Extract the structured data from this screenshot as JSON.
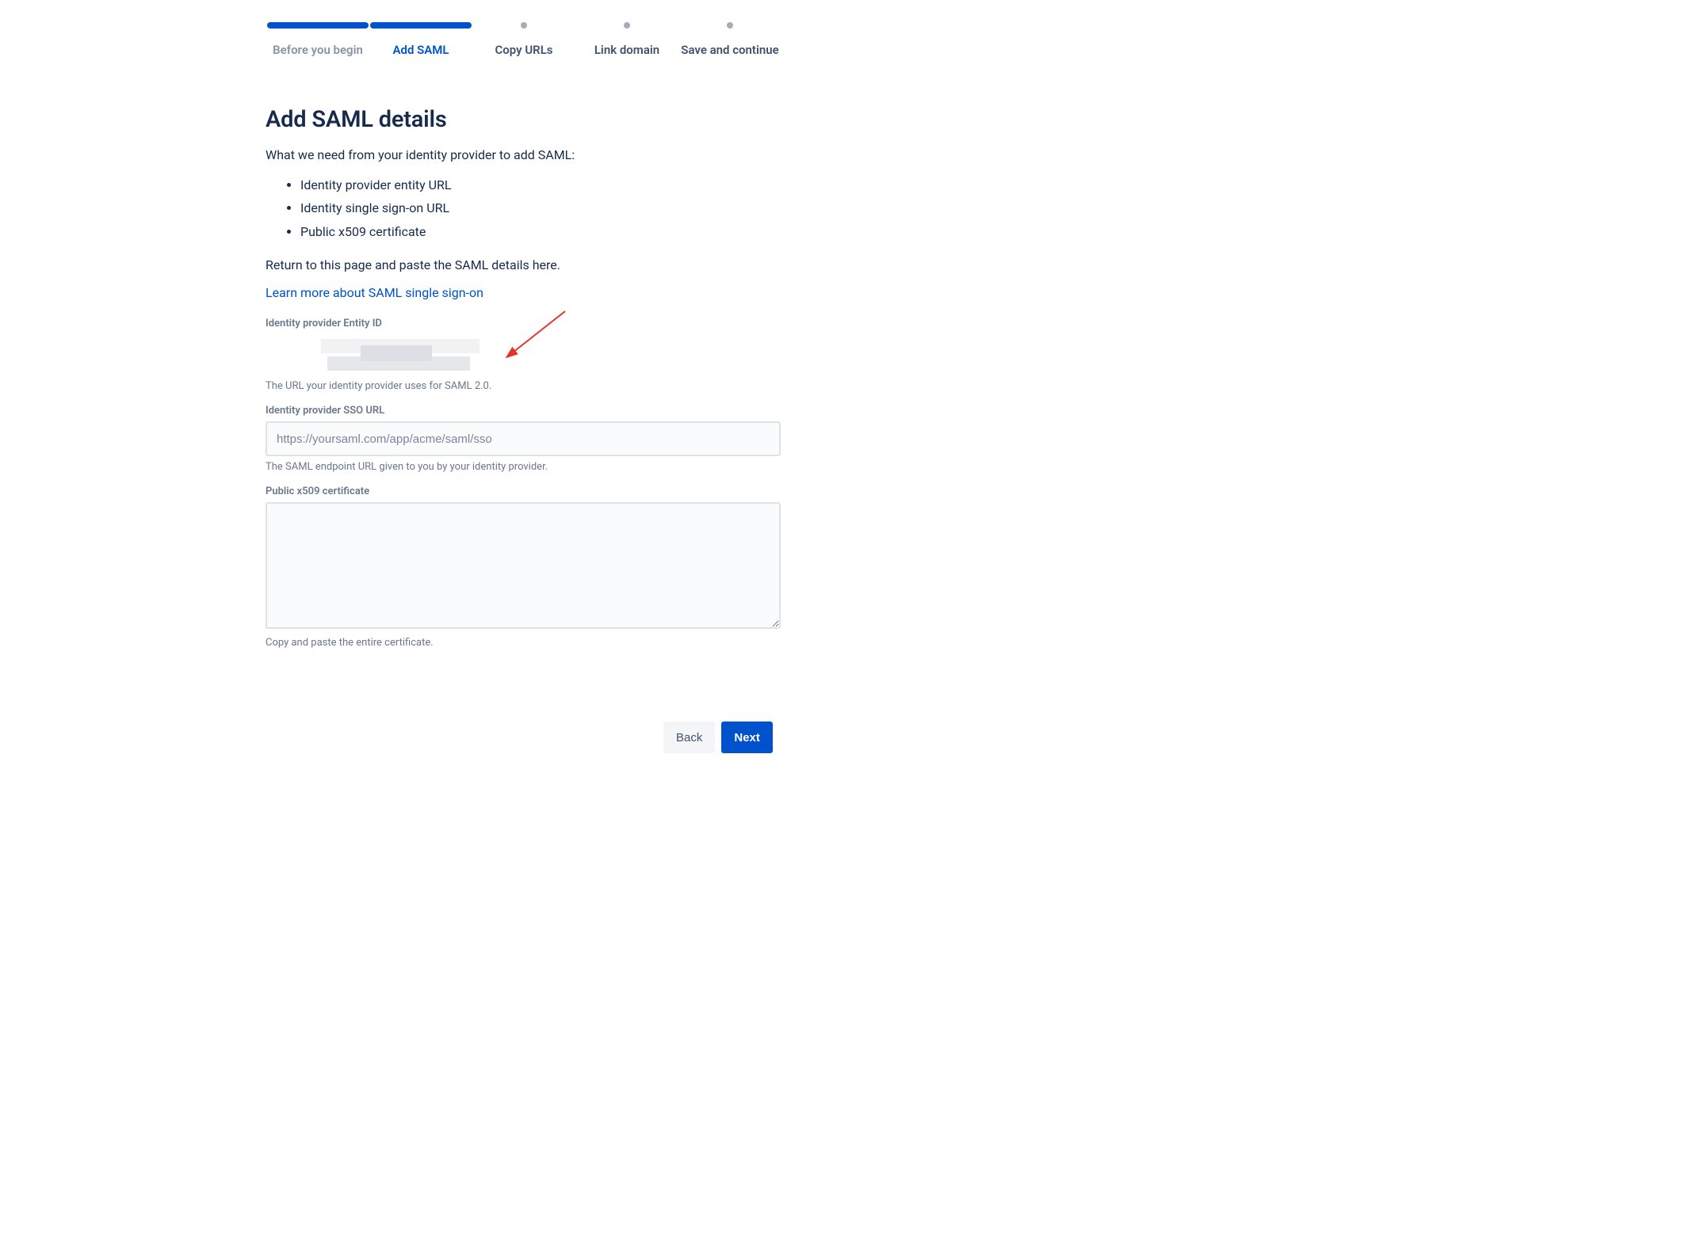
{
  "stepper": [
    {
      "label": "Before you begin",
      "state": "completed"
    },
    {
      "label": "Add SAML",
      "state": "active"
    },
    {
      "label": "Copy URLs",
      "state": "upcoming"
    },
    {
      "label": "Link domain",
      "state": "upcoming"
    },
    {
      "label": "Save and continue",
      "state": "upcoming"
    }
  ],
  "title": "Add SAML details",
  "intro": "What we need from your identity provider to add SAML:",
  "bullets": [
    "Identity provider entity URL",
    "Identity single sign-on URL",
    "Public x509 certificate"
  ],
  "return_text": "Return to this page and paste the SAML details here.",
  "learn_more": "Learn more about SAML single sign-on",
  "fields": {
    "entity_id": {
      "label": "Identity provider Entity ID",
      "helper": "The URL your identity provider uses for SAML 2.0."
    },
    "sso_url": {
      "label": "Identity provider SSO URL",
      "placeholder": "https://yoursaml.com/app/acme/saml/sso",
      "helper": "The SAML endpoint URL given to you by your identity provider."
    },
    "certificate": {
      "label": "Public x509 certificate",
      "helper": "Copy and paste the entire certificate."
    }
  },
  "buttons": {
    "back": "Back",
    "next": "Next"
  }
}
